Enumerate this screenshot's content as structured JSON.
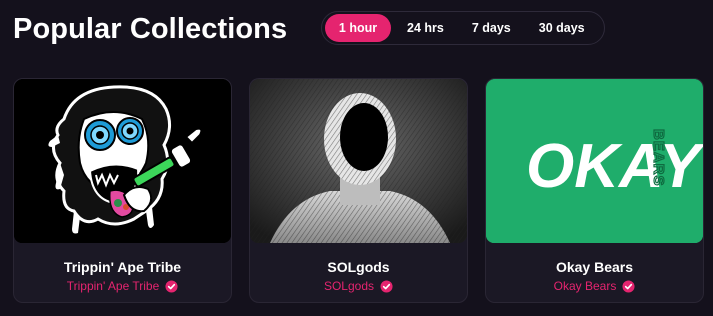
{
  "header": {
    "title": "Popular Collections"
  },
  "timeframe": {
    "options": [
      "1 hour",
      "24 hrs",
      "7 days",
      "30 days"
    ],
    "selected": "1 hour"
  },
  "colors": {
    "accent": "#e5246f",
    "background": "#14111c",
    "card": "#1b1825",
    "okay_green": "#1fad6b"
  },
  "collections": [
    {
      "name": "Trippin' Ape Tribe",
      "creator": "Trippin' Ape Tribe",
      "verified": true,
      "image": "ape-illustration"
    },
    {
      "name": "SOLgods",
      "creator": "SOLgods",
      "verified": true,
      "image": "faceless-figure-sketch"
    },
    {
      "name": "Okay Bears",
      "creator": "Okay Bears",
      "verified": true,
      "image": "okay-bears-logo",
      "logo_text": "OKAY",
      "logo_side_text": "BEARS"
    }
  ]
}
